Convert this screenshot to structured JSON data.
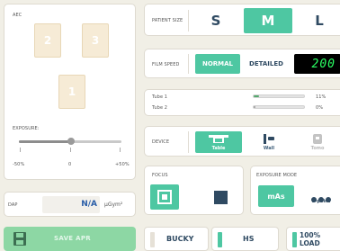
{
  "aec": {
    "title": "AEC",
    "fields": [
      "2",
      "3",
      "1"
    ],
    "exposure_label": "EXPOSURE:",
    "scale": [
      "-50%",
      "0",
      "+50%"
    ]
  },
  "patient_size": {
    "label": "PATIENT SIZE",
    "options": [
      "S",
      "M",
      "L"
    ],
    "selected": "M"
  },
  "film_speed": {
    "label": "FILM SPEED",
    "normal": "NORMAL",
    "detailed": "DETAILED",
    "counter": "200"
  },
  "tubes": [
    {
      "name": "Tube 1",
      "percent_label": "11%",
      "level": 0.11
    },
    {
      "name": "Tube 2",
      "percent_label": "0%",
      "level": 0.0
    }
  ],
  "device": {
    "label": "DEVICE",
    "options": [
      "Table",
      "Wall",
      "Tomo"
    ],
    "selected": "Table"
  },
  "focus": {
    "label": "FOCUS"
  },
  "exposure_mode": {
    "label": "EXPOSURE MODE",
    "mas": "mAs",
    "three_point": "3-point"
  },
  "dap": {
    "label": "DAP",
    "value": "N/A",
    "unit": "μGym²"
  },
  "save_apr": "SAVE APR",
  "bottom": {
    "bucky": "BUCKY",
    "hs": "HS",
    "load": "100% LOAD"
  },
  "colors": {
    "accent": "#4ec7a2",
    "background": "#f1efe6",
    "counter_text": "#2aff63"
  }
}
